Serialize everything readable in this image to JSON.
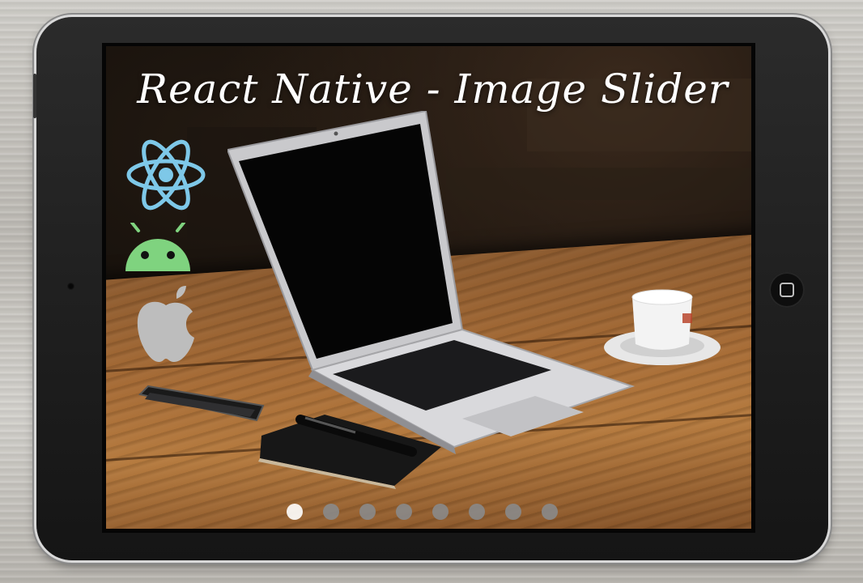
{
  "slider": {
    "title": "React Native - Image Slider",
    "slide_count": 8,
    "active_index": 0
  },
  "icons": [
    "react-icon",
    "android-icon",
    "apple-icon"
  ],
  "colors": {
    "react": "#7ec8e8",
    "android": "#7fd37f",
    "apple": "#bdbdbd",
    "dot_active": "#ffffff",
    "dot_inactive": "#8a8a8a"
  }
}
